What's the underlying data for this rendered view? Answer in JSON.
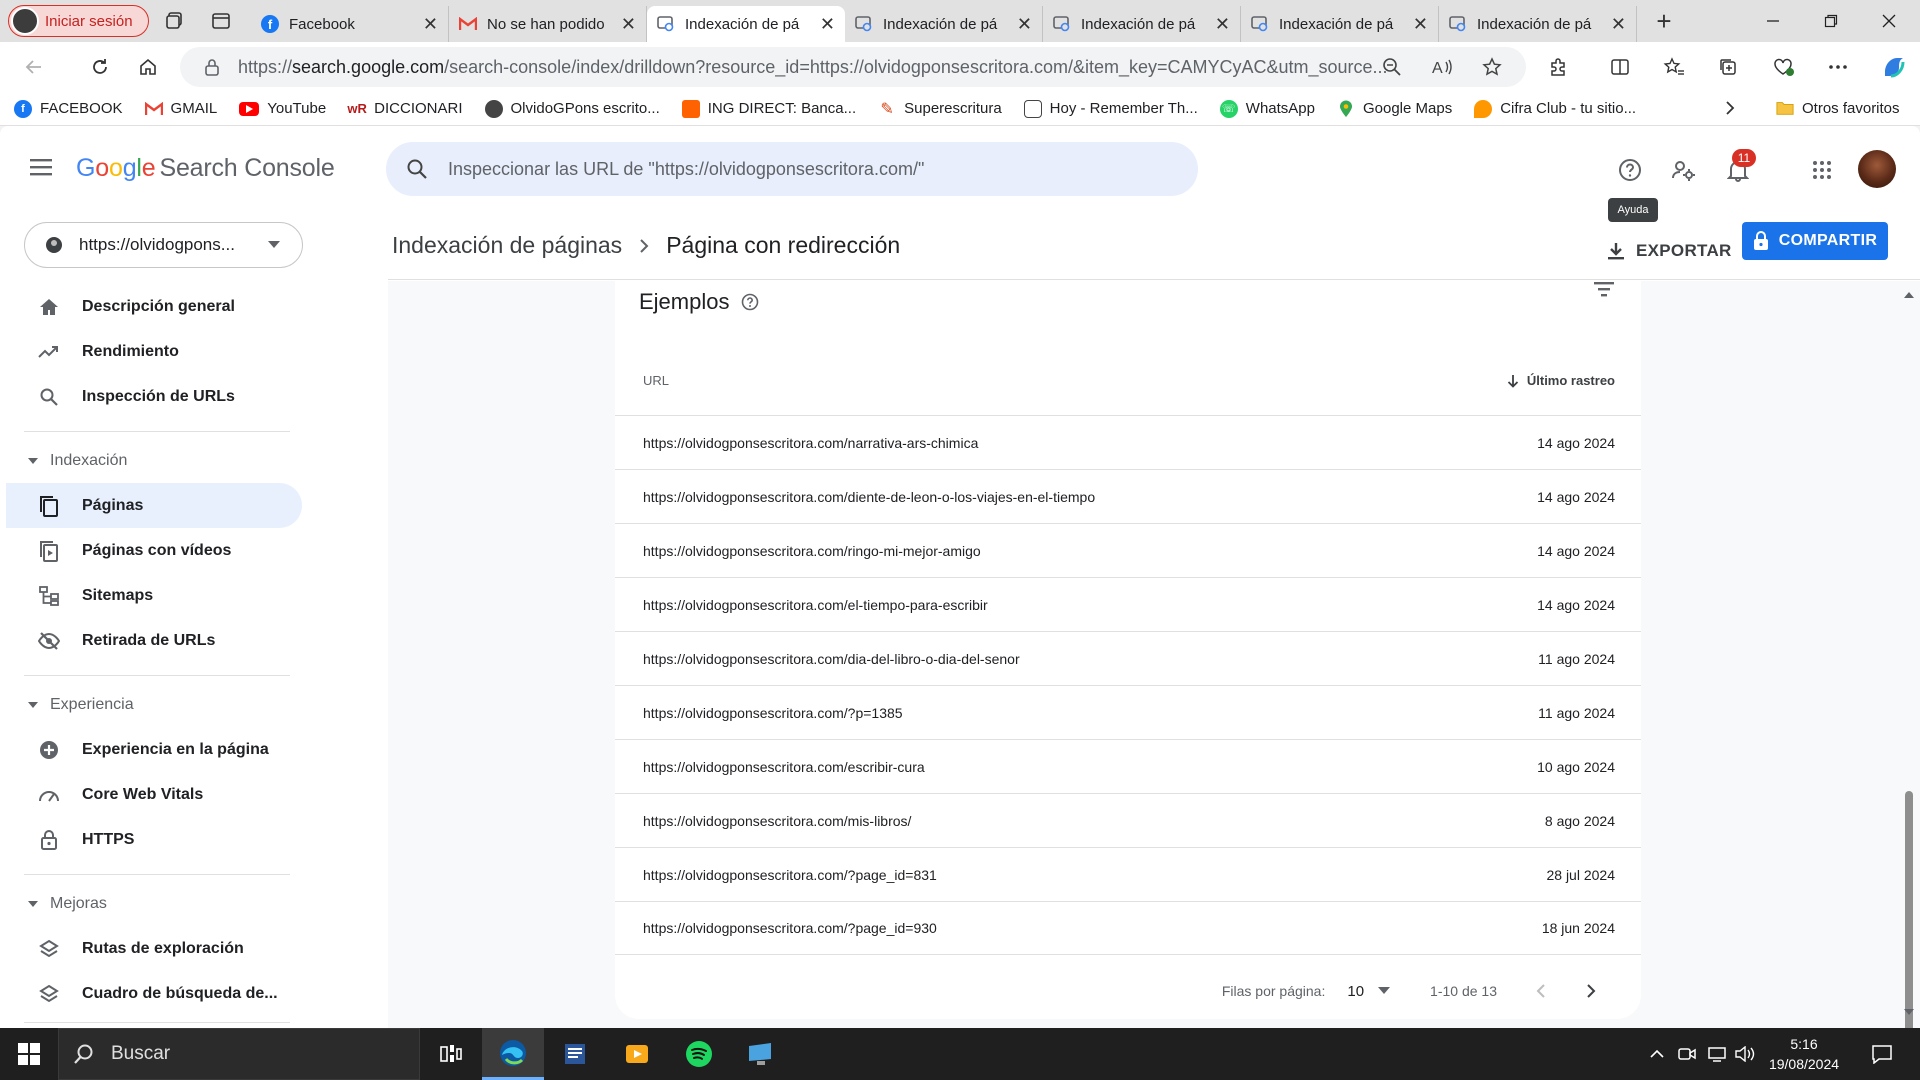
{
  "browser": {
    "profile_label": "Iniciar sesión",
    "tabs": [
      {
        "title": "Facebook"
      },
      {
        "title": "No se han podido"
      },
      {
        "title": "Indexación de pá"
      },
      {
        "title": "Indexación de pá"
      },
      {
        "title": "Indexación de pá"
      },
      {
        "title": "Indexación de pá"
      },
      {
        "title": "Indexación de pá"
      }
    ],
    "url_scheme": "https://",
    "url_host": "search.google.com",
    "url_path": "/search-console/index/drilldown?resource_id=https://olvidogponsescritora.com/&item_key=CAMYCyAC&utm_source...",
    "favorites": [
      {
        "label": "FACEBOOK"
      },
      {
        "label": "GMAIL"
      },
      {
        "label": "YouTube"
      },
      {
        "label": "DICCIONARI"
      },
      {
        "label": "OlvidoGPons escrito..."
      },
      {
        "label": "ING DIRECT: Banca..."
      },
      {
        "label": "Superescritura"
      },
      {
        "label": "Hoy - Remember Th..."
      },
      {
        "label": "WhatsApp"
      },
      {
        "label": "Google Maps"
      },
      {
        "label": "Cifra Club - tu sitio..."
      }
    ],
    "other_favorites": "Otros favoritos",
    "colors": {
      "edge_blue": "#0c59a4",
      "accent": "#1a73e8"
    }
  },
  "gsc": {
    "logo_google": [
      "G",
      "o",
      "o",
      "g",
      "l",
      "e"
    ],
    "logo_product": "Search Console",
    "search_placeholder": "Inspeccionar las URL de \"https://olvidogponsescritora.com/\"",
    "notifications_count": "11",
    "tooltip": "Ayuda",
    "property": "https://olvidogpons...",
    "breadcrumb_parent": "Indexación de páginas",
    "breadcrumb_current": "Página con redirección",
    "export_label": "EXPORTAR",
    "share_label": "COMPARTIR"
  },
  "sidebar": {
    "top": [
      {
        "label": "Descripción general",
        "icon": "home-icon"
      },
      {
        "label": "Rendimiento",
        "icon": "trending-icon"
      },
      {
        "label": "Inspección de URLs",
        "icon": "search-icon"
      }
    ],
    "section_indexacion": "Indexación",
    "indexacion": [
      {
        "label": "Páginas",
        "icon": "pages-icon"
      },
      {
        "label": "Páginas con vídeos",
        "icon": "video-pages-icon"
      },
      {
        "label": "Sitemaps",
        "icon": "sitemap-icon"
      },
      {
        "label": "Retirada de URLs",
        "icon": "eye-off-icon"
      }
    ],
    "section_experiencia": "Experiencia",
    "experiencia": [
      {
        "label": "Experiencia en la página",
        "icon": "plus-circle-icon"
      },
      {
        "label": "Core Web Vitals",
        "icon": "gauge-icon"
      },
      {
        "label": "HTTPS",
        "icon": "lock-icon"
      }
    ],
    "section_mejoras": "Mejoras",
    "mejoras": [
      {
        "label": "Rutas de exploración",
        "icon": "layers-icon"
      },
      {
        "label": "Cuadro de búsqueda de...",
        "icon": "layers-icon"
      }
    ]
  },
  "examples": {
    "title": "Ejemplos",
    "col_url": "URL",
    "col_date": "Último rastreo",
    "rows": [
      {
        "url": "https://olvidogponsescritora.com/narrativa-ars-chimica",
        "date": "14 ago 2024"
      },
      {
        "url": "https://olvidogponsescritora.com/diente-de-leon-o-los-viajes-en-el-tiempo",
        "date": "14 ago 2024"
      },
      {
        "url": "https://olvidogponsescritora.com/ringo-mi-mejor-amigo",
        "date": "14 ago 2024"
      },
      {
        "url": "https://olvidogponsescritora.com/el-tiempo-para-escribir",
        "date": "14 ago 2024"
      },
      {
        "url": "https://olvidogponsescritora.com/dia-del-libro-o-dia-del-senor",
        "date": "11 ago 2024"
      },
      {
        "url": "https://olvidogponsescritora.com/?p=1385",
        "date": "11 ago 2024"
      },
      {
        "url": "https://olvidogponsescritora.com/escribir-cura",
        "date": "10 ago 2024"
      },
      {
        "url": "https://olvidogponsescritora.com/mis-libros/",
        "date": "8 ago 2024"
      },
      {
        "url": "https://olvidogponsescritora.com/?page_id=831",
        "date": "28 jul 2024"
      },
      {
        "url": "https://olvidogponsescritora.com/?page_id=930",
        "date": "18 jun 2024"
      }
    ],
    "rows_per_page_label": "Filas por página:",
    "rows_per_page_value": "10",
    "range": "1-10 de 13"
  },
  "taskbar": {
    "search_label": "Buscar",
    "time": "5:16",
    "date": "19/08/2024"
  }
}
